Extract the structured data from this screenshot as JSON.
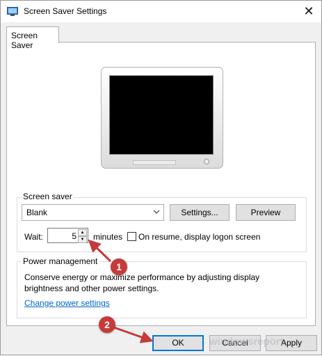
{
  "window": {
    "title": "Screen Saver Settings",
    "close_glyph": "✕"
  },
  "tabs": [
    {
      "label": "Screen Saver"
    }
  ],
  "screen_saver": {
    "group_label": "Screen saver",
    "selected": "Blank",
    "settings_label": "Settings...",
    "preview_label": "Preview",
    "wait_label": "Wait:",
    "wait_value": "5",
    "minutes_label": "minutes",
    "resume_label": "On resume, display logon screen",
    "resume_checked": false
  },
  "power": {
    "group_label": "Power management",
    "description": "Conserve energy or maximize performance by adjusting display brightness and other power settings.",
    "link": "Change power settings"
  },
  "buttons": {
    "ok": "OK",
    "cancel": "Cancel",
    "apply": "Apply"
  },
  "annotations": [
    {
      "label": "1"
    },
    {
      "label": "2"
    }
  ],
  "watermark": "windowsreport",
  "colors": {
    "marker": "#c73a3a",
    "link": "#0066cc",
    "focus": "#0078d7"
  }
}
